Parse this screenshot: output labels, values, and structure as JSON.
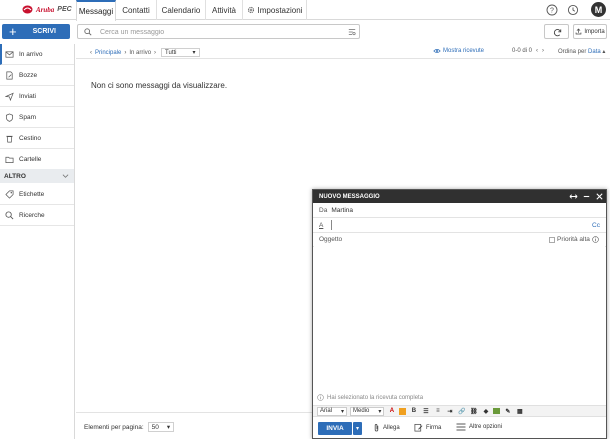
{
  "header": {
    "brand": "Aruba",
    "brand_suffix": "PEC",
    "tabs": [
      "Messaggi",
      "Contatti",
      "Calendario",
      "Attività",
      "Impostazioni"
    ],
    "avatar_initial": "M"
  },
  "toolbar": {
    "compose_label": "SCRIVI",
    "search_placeholder": "Cerca un messaggio",
    "import_label": "Importa"
  },
  "sidebar": {
    "items": [
      "In arrivo",
      "Bozze",
      "Inviati",
      "Spam",
      "Cestino",
      "Cartelle"
    ],
    "section_label": "ALTRO",
    "section_items": [
      "Etichette",
      "Ricerche"
    ]
  },
  "list": {
    "crumb_root": "Principale",
    "crumb_folder": "In arrivo",
    "filter_value": "Tutti",
    "show_unread": "Mostra ricevute",
    "pager": "0-0 di 0",
    "sort_label": "Ordina per",
    "sort_value": "Data",
    "empty_text": "Non ci sono messaggi da visualizzare."
  },
  "footer": {
    "per_page_label": "Elementi per pagina:",
    "per_page_value": "50"
  },
  "compose": {
    "title": "NUOVO MESSAGGIO",
    "from_label": "Da",
    "from_value": "Martina",
    "to_label": "A",
    "cc_label": "Cc",
    "subject_label": "Oggetto",
    "priority_label": "Priorità alta",
    "info_text": "Hai selezionato la ricevuta completa",
    "font_value": "Arial",
    "size_value": "Medio",
    "send_label": "INVIA",
    "attach_label": "Allega",
    "sign_label": "Firma",
    "more_label": "Altre opzioni"
  },
  "colors": {
    "accent": "#2d6db8",
    "brand_red": "#c8102e",
    "compose_title_bg": "#303030"
  }
}
